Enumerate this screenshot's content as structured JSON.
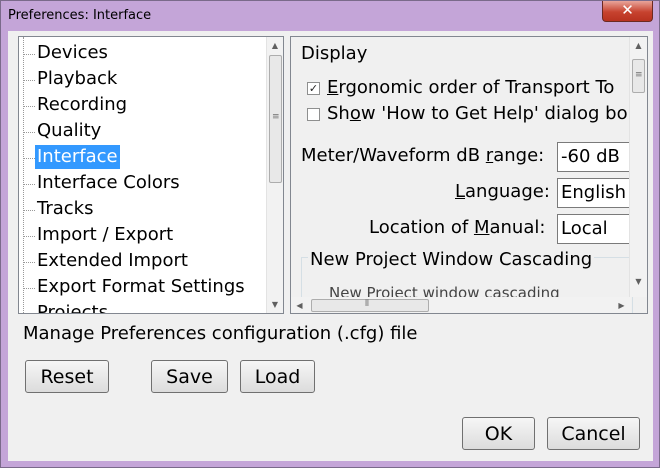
{
  "window": {
    "title": "Preferences: Interface",
    "close_glyph": "✕"
  },
  "tree": {
    "items": [
      "Devices",
      "Playback",
      "Recording",
      "Quality",
      "Interface",
      "Interface Colors",
      "Tracks",
      "Import / Export",
      "Extended Import",
      "Export Format Settings",
      "Projects"
    ],
    "selected": "Interface"
  },
  "panel": {
    "section": "Display",
    "ergonomic": {
      "pre": "",
      "u": "E",
      "post": "rgonomic order of Transport To",
      "checked": true
    },
    "showhelp": {
      "pre": "Sh",
      "u": "o",
      "post": "w 'How to Get Help' dialog bo",
      "checked": false
    },
    "meter": {
      "pre": "Meter/Waveform dB ",
      "u": "r",
      "post": "ange:",
      "value": "-60 dB"
    },
    "language": {
      "pre": "",
      "u": "L",
      "post": "anguage:",
      "value": "English"
    },
    "manual": {
      "pre": "Location of ",
      "u": "M",
      "post": "anual:",
      "value": "Local"
    },
    "cascading": "New Project Window Cascading",
    "cut_text": "New Project window cascading"
  },
  "description": "Manage Preferences configuration (.cfg) file",
  "buttons": {
    "reset": "Reset",
    "save": "Save",
    "load": "Load",
    "ok": "OK",
    "cancel": "Cancel"
  },
  "check_glyph": "✓"
}
